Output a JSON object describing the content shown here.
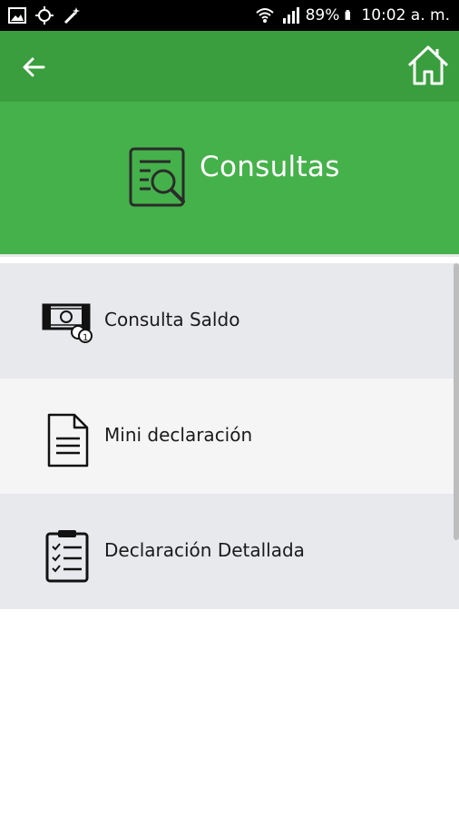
{
  "status_bar": {
    "battery": "89%",
    "time": "10:02 a. m."
  },
  "app_bar": {
    "back_icon": "arrow-left-icon",
    "home_icon": "home-icon"
  },
  "header": {
    "title": "Consultas",
    "icon": "document-search-icon"
  },
  "menu": {
    "items": [
      {
        "label": "Consulta Saldo",
        "icon": "money-bill-icon"
      },
      {
        "label": "Mini declaración",
        "icon": "document-icon"
      },
      {
        "label": "Declaración Detallada",
        "icon": "clipboard-checklist-icon"
      }
    ]
  },
  "colors": {
    "app_bar": "#3a9e3e",
    "header": "#45b14a",
    "row_gray": "#e8e9ed",
    "row_light": "#f5f5f5"
  }
}
